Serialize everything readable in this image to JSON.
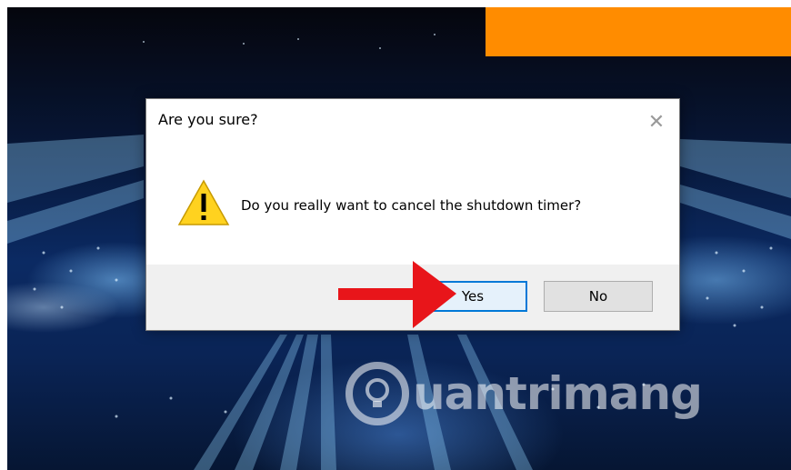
{
  "dialog": {
    "title": "Are you sure?",
    "message": "Do you really want to cancel the shutdown timer?",
    "icon": "warning-icon",
    "close_icon": "close-icon",
    "buttons": {
      "yes_label": "Yes",
      "no_label": "No"
    }
  },
  "watermark": {
    "text": "uantrimang"
  },
  "colors": {
    "accent": "#0078d7",
    "banner": "#ff8c00",
    "arrow": "#e8151a",
    "warning_fill": "#ffd21f",
    "button_bar": "#f0f0f0"
  }
}
